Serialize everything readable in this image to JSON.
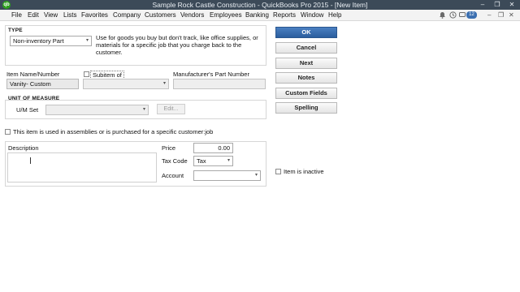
{
  "window": {
    "title": "Sample Rock Castle Construction  - QuickBooks Pro 2015 - [New Item]",
    "logo_text": "qb",
    "controls": [
      "–",
      "❐",
      "✕"
    ]
  },
  "menu": {
    "items": [
      "File",
      "Edit",
      "View",
      "Lists",
      "Favorites",
      "Company",
      "Customers",
      "Vendors",
      "Employees",
      "Banking",
      "Reports",
      "Window",
      "Help"
    ],
    "right_badge": "12",
    "right_controls": [
      "–",
      "❐",
      "✕"
    ]
  },
  "form": {
    "type_label": "TYPE",
    "type_value": "Non-inventory Part",
    "type_description": "Use for goods you buy but don't track, like office supplies, or materials for a specific job that you charge back to the customer.",
    "item_name_label": "Item Name/Number",
    "item_name_value": "Vanity- Custom",
    "subitem_label": "Subitem of",
    "mpn_label": "Manufacturer's Part Number",
    "uom_section_label": "UNIT OF MEASURE",
    "um_set_label": "U/M Set",
    "edit_label": "Edit...",
    "assemblies_label": "This item is used in assemblies or is purchased for a specific customer:job",
    "description_label": "Description",
    "price_label": "Price",
    "price_value": "0.00",
    "tax_code_label": "Tax Code",
    "tax_code_value": "Tax",
    "account_label": "Account",
    "inactive_label": "Item is inactive"
  },
  "buttons": {
    "ok": "OK",
    "cancel": "Cancel",
    "next": "Next",
    "notes": "Notes",
    "custom_fields": "Custom Fields",
    "spelling": "Spelling"
  },
  "colors": {
    "titlebar": "#3c4a58",
    "ok_button": "#2b5e9e",
    "qb_green": "#2ca01c"
  }
}
